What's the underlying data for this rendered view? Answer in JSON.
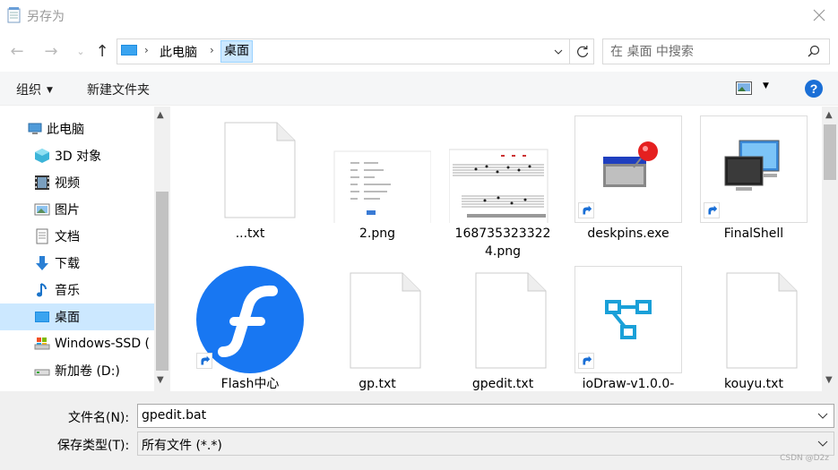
{
  "window": {
    "title": "另存为"
  },
  "address": {
    "crumbs": [
      "此电脑",
      "桌面"
    ]
  },
  "search": {
    "placeholder": "在 桌面 中搜索"
  },
  "toolbar": {
    "organize": "组织",
    "new_folder": "新建文件夹",
    "help": "?"
  },
  "tree": {
    "items": [
      {
        "label": "此电脑",
        "icon": "computer-icon"
      },
      {
        "label": "3D 对象",
        "icon": "3d-objects-icon"
      },
      {
        "label": "视频",
        "icon": "video-icon"
      },
      {
        "label": "图片",
        "icon": "pictures-icon"
      },
      {
        "label": "文档",
        "icon": "documents-icon"
      },
      {
        "label": "下载",
        "icon": "download-icon"
      },
      {
        "label": "音乐",
        "icon": "music-icon"
      },
      {
        "label": "桌面",
        "icon": "desktop-icon",
        "selected": true
      },
      {
        "label": "Windows-SSD (",
        "icon": "drive-icon"
      },
      {
        "label": "新加卷 (D:)",
        "icon": "drive-icon"
      }
    ]
  },
  "files": [
    {
      "name": "...txt",
      "type": "text"
    },
    {
      "name": "2.png",
      "type": "image"
    },
    {
      "name": "1687353233222\n4.png",
      "name_line1": "168735323322",
      "name_line2": "4.png",
      "type": "image-music"
    },
    {
      "name": "deskpins.exe",
      "type": "shortcut-app"
    },
    {
      "name": "FinalShell",
      "type": "shortcut-app"
    },
    {
      "name": "Flash中心",
      "type": "shortcut-flash"
    },
    {
      "name": "gp.txt",
      "type": "text"
    },
    {
      "name": "gpedit.txt",
      "type": "text"
    },
    {
      "name": "ioDraw-v1.0.0-",
      "type": "shortcut-iodraw"
    },
    {
      "name": "kouyu.txt",
      "type": "text"
    }
  ],
  "bottom": {
    "filename_label": "文件名(N):",
    "filename_value": "gpedit.bat",
    "filetype_label": "保存类型(T):",
    "filetype_value": "所有文件  (*.*)"
  },
  "watermark": "CSDN @D2z",
  "colors": {
    "selection": "#cce8ff",
    "accent": "#1a6fd6",
    "flash": "#1877f2"
  }
}
